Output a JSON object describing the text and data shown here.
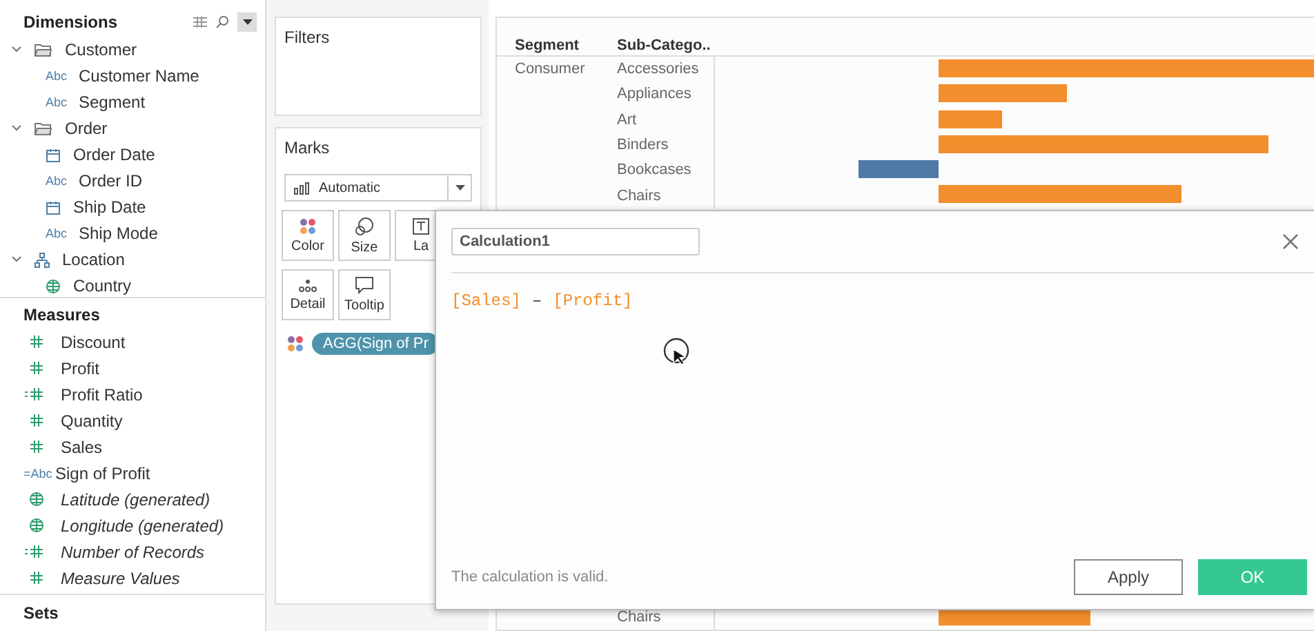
{
  "data_pane": {
    "dimensions": {
      "title": "Dimensions",
      "items": [
        {
          "label": "Customer",
          "kind": "folder",
          "expanded": true,
          "children": [
            {
              "label": "Customer Name",
              "kind": "abc",
              "badge": "Abc"
            },
            {
              "label": "Segment",
              "kind": "abc",
              "badge": "Abc"
            }
          ]
        },
        {
          "label": "Order",
          "kind": "folder",
          "expanded": true,
          "children": [
            {
              "label": "Order Date",
              "kind": "date"
            },
            {
              "label": "Order ID",
              "kind": "abc",
              "badge": "Abc"
            },
            {
              "label": "Ship Date",
              "kind": "date"
            },
            {
              "label": "Ship Mode",
              "kind": "abc",
              "badge": "Abc"
            }
          ]
        },
        {
          "label": "Location",
          "kind": "hierarchy",
          "expanded": true,
          "children": [
            {
              "label": "Country",
              "kind": "geo"
            }
          ]
        }
      ]
    },
    "measures": {
      "title": "Measures",
      "items": [
        {
          "label": "Discount",
          "kind": "measure",
          "generated": false
        },
        {
          "label": "Profit",
          "kind": "measure",
          "generated": false
        },
        {
          "label": "Profit Ratio",
          "kind": "calc-measure",
          "generated": false
        },
        {
          "label": "Quantity",
          "kind": "measure",
          "generated": false
        },
        {
          "label": "Sales",
          "kind": "measure",
          "generated": false
        },
        {
          "label": "Sign of Profit",
          "kind": "calc-abc",
          "badge": "=Abc",
          "generated": false
        },
        {
          "label": "Latitude (generated)",
          "kind": "geo",
          "generated": true
        },
        {
          "label": "Longitude (generated)",
          "kind": "geo",
          "generated": true
        },
        {
          "label": "Number of Records",
          "kind": "calc-measure",
          "generated": true
        },
        {
          "label": "Measure Values",
          "kind": "measure",
          "generated": true
        }
      ]
    },
    "next_section": "Sets"
  },
  "filters": {
    "title": "Filters"
  },
  "marks": {
    "title": "Marks",
    "mark_type": "Automatic",
    "tiles": [
      {
        "label": "Color",
        "kind": "color"
      },
      {
        "label": "Size",
        "kind": "size"
      },
      {
        "label": "La",
        "kind": "label"
      },
      {
        "label": "Detail",
        "kind": "detail"
      },
      {
        "label": "Tooltip",
        "kind": "tooltip"
      }
    ],
    "pill": "AGG(Sign of Pr"
  },
  "view": {
    "columns": [
      "Segment",
      "Sub-Catego.."
    ],
    "segment": "Consumer",
    "rows": [
      {
        "sub_category": "Accessories",
        "color": "#f28e2b"
      },
      {
        "sub_category": "Appliances",
        "color": "#f28e2b"
      },
      {
        "sub_category": "Art",
        "color": "#f28e2b"
      },
      {
        "sub_category": "Binders",
        "color": "#f28e2b"
      },
      {
        "sub_category": "Bookcases",
        "color": "#4e79a7"
      },
      {
        "sub_category": "Chairs",
        "color": "#f28e2b"
      }
    ],
    "bottom_row": {
      "sub_category": "Chairs",
      "color": "#f28e2b"
    }
  },
  "dialog": {
    "name": "Calculation1",
    "formula": [
      {
        "text": "[Sales]",
        "kind": "field"
      },
      {
        "text": "–",
        "kind": "operator"
      },
      {
        "text": "[Profit]",
        "kind": "field"
      }
    ],
    "status": "The calculation is valid.",
    "buttons": [
      {
        "label": "Apply",
        "kind": "secondary"
      },
      {
        "label": "OK",
        "kind": "primary"
      }
    ]
  }
}
